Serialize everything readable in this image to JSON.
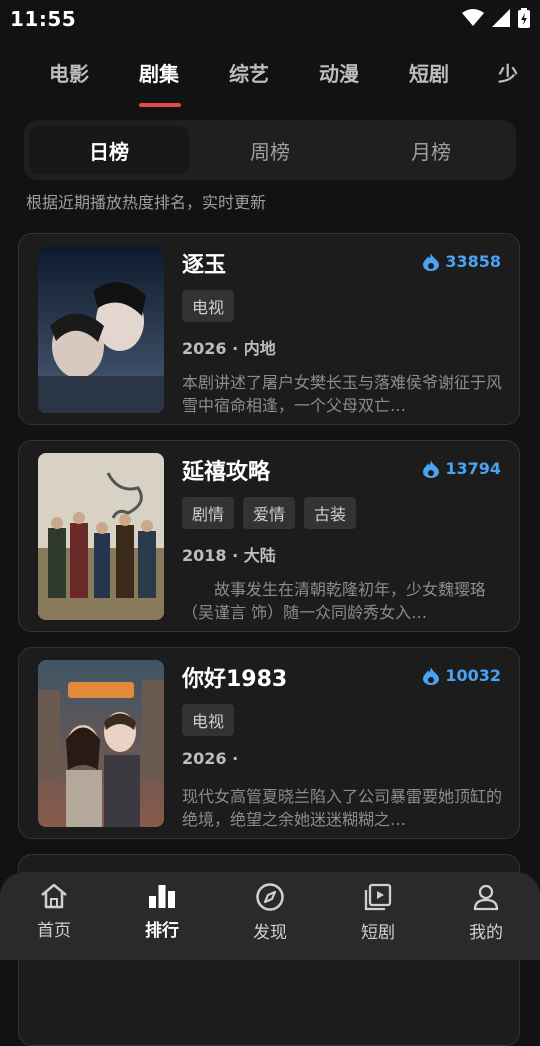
{
  "status": {
    "time": "11:55"
  },
  "categories": [
    {
      "label": "电影"
    },
    {
      "label": "剧集"
    },
    {
      "label": "综艺"
    },
    {
      "label": "动漫"
    },
    {
      "label": "短剧"
    },
    {
      "label": "少"
    }
  ],
  "active_category": "剧集",
  "ranking_tabs": [
    {
      "label": "日榜"
    },
    {
      "label": "周榜"
    },
    {
      "label": "月榜"
    }
  ],
  "active_ranking": "日榜",
  "subtitle": "根据近期播放热度排名，实时更新",
  "items": [
    {
      "title": "逐玉",
      "heat": "33858",
      "tags": [
        "电视"
      ],
      "meta": "2026 · 内地",
      "desc": "本剧讲述了屠户女樊长玉与落难侯爷谢征于风雪中宿命相逢，一个父母双亡…"
    },
    {
      "title": "延禧攻略",
      "heat": "13794",
      "tags": [
        "剧情",
        "爱情",
        "古装"
      ],
      "meta": "2018 · 大陆",
      "desc": "　　故事发生在清朝乾隆初年，少女魏璎珞（吴谨言 饰）随一众同龄秀女入…"
    },
    {
      "title": "你好1983",
      "heat": "10032",
      "tags": [
        "电视"
      ],
      "meta": "2026 ·",
      "desc": "现代女高管夏晓兰陷入了公司暴雷要她顶缸的绝境，绝望之余她迷迷糊糊之…"
    }
  ],
  "nav": [
    {
      "label": "首页",
      "icon": "home-icon"
    },
    {
      "label": "排行",
      "icon": "ranking-icon"
    },
    {
      "label": "发现",
      "icon": "compass-icon"
    },
    {
      "label": "短剧",
      "icon": "video-icon"
    },
    {
      "label": "我的",
      "icon": "user-icon"
    }
  ],
  "active_nav": "排行",
  "colors": {
    "accent": "#e24b4b",
    "heat": "#4aa3f0",
    "background": "#121212"
  }
}
